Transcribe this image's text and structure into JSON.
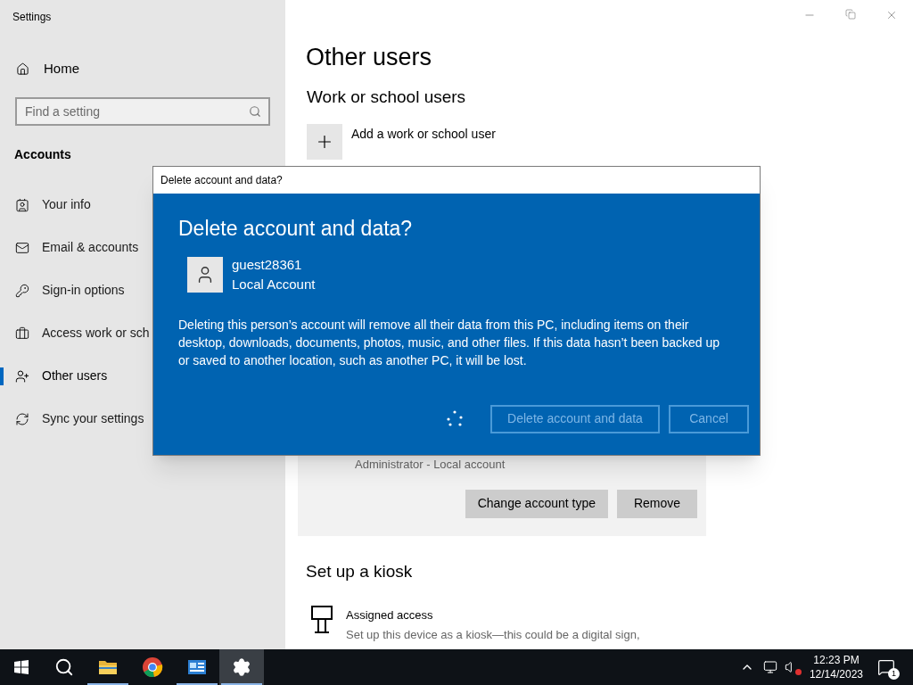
{
  "window": {
    "title": "Settings"
  },
  "sidebar": {
    "home": "Home",
    "search": {
      "placeholder": "Find a setting"
    },
    "section": "Accounts",
    "items": [
      {
        "label": "Your info",
        "selected": false
      },
      {
        "label": "Email & accounts",
        "selected": false
      },
      {
        "label": "Sign-in options",
        "selected": false
      },
      {
        "label": "Access work or sch",
        "selected": false
      },
      {
        "label": "Other users",
        "selected": true
      },
      {
        "label": "Sync your settings",
        "selected": false
      }
    ]
  },
  "main": {
    "title": "Other users",
    "work_section": "Work or school users",
    "add_label": "Add a work or school user",
    "admin_subtitle": "Administrator - Local account",
    "card_buttons": [
      "Change account type",
      "Remove"
    ],
    "kiosk_title": "Set up a kiosk",
    "kiosk_item": {
      "title": "Assigned access",
      "description": "Set up this device as a kiosk—this could be a digital sign,"
    }
  },
  "dialog": {
    "title": "Delete account and data?",
    "heading": "Delete account and data?",
    "user_name": "guest28361",
    "user_type": "Local Account",
    "message": "Deleting this person’s account will remove all their data from this PC, including items on their desktop, downloads, documents, photos, music, and other files. If this data hasn’t been backed up or saved to another location, such as another PC, it will be lost.",
    "busy": true,
    "buttons": [
      {
        "label": "Delete account and data",
        "disabled": true
      },
      {
        "label": "Cancel",
        "disabled": true
      }
    ]
  },
  "taskbar": {
    "apps": [
      {
        "selected": false,
        "running": true
      },
      {
        "selected": false,
        "running": false
      },
      {
        "selected": false,
        "running": true
      },
      {
        "selected": true,
        "running": true
      }
    ],
    "time": "12:23 PM",
    "date": "12/14/2023",
    "notifications": "1"
  }
}
